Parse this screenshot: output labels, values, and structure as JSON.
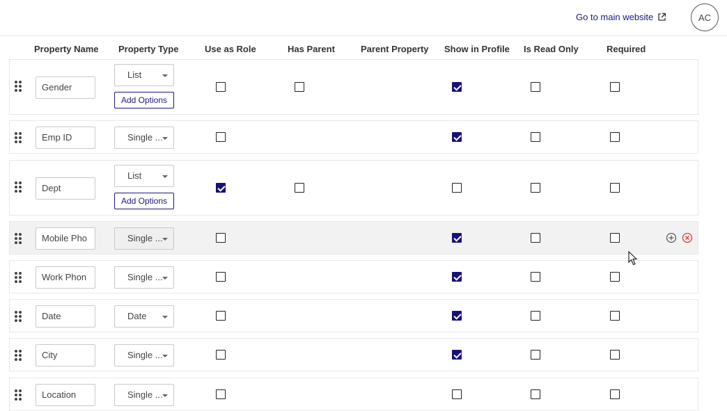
{
  "header": {
    "main_link": "Go to main website",
    "avatar_initials": "AC"
  },
  "columns": {
    "property_name": "Property Name",
    "property_type": "Property Type",
    "use_as_role": "Use as Role",
    "has_parent": "Has Parent",
    "parent_property": "Parent Property",
    "show_in_profile": "Show in Profile",
    "is_read_only": "Is Read Only",
    "required": "Required"
  },
  "add_options_label": "Add Options",
  "rows": [
    {
      "name": "Gender",
      "type": "List",
      "add_options": true,
      "use_as_role": false,
      "has_parent": false,
      "show_in_profile": true,
      "read_only": false,
      "required": false
    },
    {
      "name": "Emp ID",
      "type": "Single ...",
      "add_options": false,
      "use_as_role": false,
      "show_in_profile": true,
      "read_only": false,
      "required": false
    },
    {
      "name": "Dept",
      "type": "List",
      "add_options": true,
      "use_as_role": true,
      "has_parent": false,
      "show_in_profile": false,
      "read_only": false,
      "required": false
    },
    {
      "name": "Mobile Pho",
      "type": "Single ...",
      "add_options": false,
      "use_as_role": false,
      "show_in_profile": true,
      "read_only": false,
      "required": false,
      "hovered": true
    },
    {
      "name": "Work Phon",
      "type": "Single ...",
      "add_options": false,
      "use_as_role": false,
      "show_in_profile": true,
      "read_only": false,
      "required": false
    },
    {
      "name": "Date",
      "type": "Date",
      "add_options": false,
      "use_as_role": false,
      "show_in_profile": true,
      "read_only": false,
      "required": false
    },
    {
      "name": "City",
      "type": "Single ...",
      "add_options": false,
      "use_as_role": false,
      "show_in_profile": true,
      "read_only": false,
      "required": false
    },
    {
      "name": "Location",
      "type": "Single ...",
      "add_options": false,
      "use_as_role": false,
      "show_in_profile": false,
      "read_only": false,
      "required": false
    }
  ],
  "colors": {
    "accent": "#16127a",
    "delete": "#e53935"
  },
  "icons": {
    "external_link": "external-link-icon",
    "add": "plus-circle-icon",
    "delete": "close-circle-icon",
    "drag": "drag-handle-icon"
  }
}
